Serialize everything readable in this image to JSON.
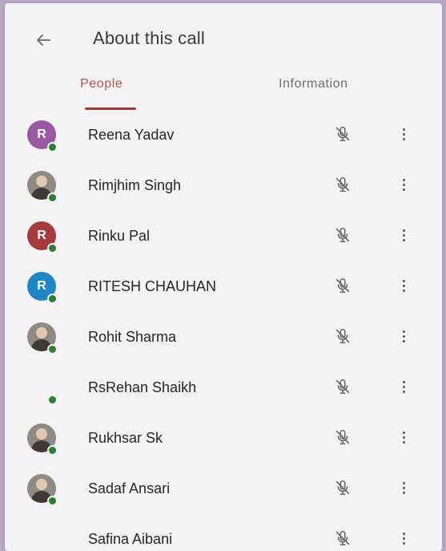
{
  "header": {
    "title": "About this call"
  },
  "tabs": [
    {
      "label": "People",
      "active": true
    },
    {
      "label": "Information",
      "active": false
    }
  ],
  "colors": {
    "accent": "#b0574a",
    "online": "#2e7d32"
  },
  "icons": {
    "back": "arrow-left-icon",
    "mic": "mic-off-icon",
    "menu": "more-vert-icon"
  },
  "participants": [
    {
      "name": "Reena Yadav",
      "avatar_type": "initial",
      "initial": "R",
      "avatar_color": "#9a5aa3",
      "online": true,
      "muted": true
    },
    {
      "name": "Rimjhim Singh",
      "avatar_type": "photo",
      "online": true,
      "muted": true
    },
    {
      "name": "Rinku Pal",
      "avatar_type": "initial",
      "initial": "R",
      "avatar_color": "#a63a3f",
      "online": true,
      "muted": true
    },
    {
      "name": "RITESH CHAUHAN",
      "avatar_type": "initial",
      "initial": "R",
      "avatar_color": "#1f86c6",
      "online": true,
      "muted": true
    },
    {
      "name": "Rohit Sharma",
      "avatar_type": "photo",
      "online": true,
      "muted": true
    },
    {
      "name": "RsRehan Shaikh",
      "avatar_type": "none",
      "online": true,
      "muted": true
    },
    {
      "name": "Rukhsar Sk",
      "avatar_type": "photo",
      "online": true,
      "muted": true
    },
    {
      "name": "Sadaf Ansari",
      "avatar_type": "photo",
      "online": true,
      "muted": true
    },
    {
      "name": "Safina Aibani",
      "avatar_type": "none",
      "online": false,
      "muted": true
    }
  ]
}
